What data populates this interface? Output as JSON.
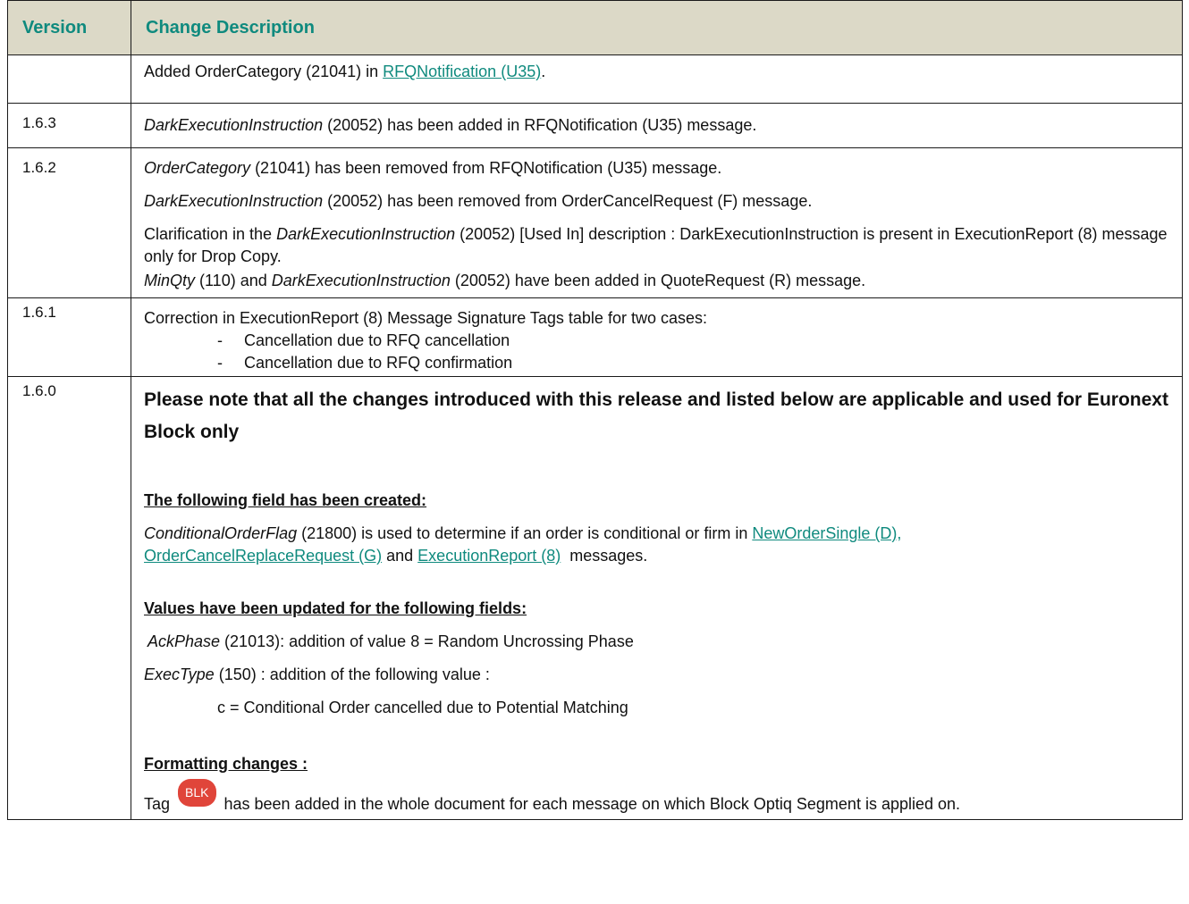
{
  "header": {
    "version": "Version",
    "change_description": "Change Description"
  },
  "row0": {
    "pre": "Added OrderCategory (21041) in ",
    "link": "RFQNotification (U35)",
    "post": "."
  },
  "row1": {
    "version": "1.6.3",
    "em": "DarkExecutionInstruction",
    "rest": " (20052) has been added in RFQNotification (U35) message."
  },
  "row2": {
    "version": "1.6.2",
    "l1_em": "OrderCategory",
    "l1_rest": " (21041) has been removed from RFQNotification (U35) message.",
    "l2_em": "DarkExecutionInstruction",
    "l2_rest": " (20052) has been removed from OrderCancelRequest (F) message.",
    "l3_pre": "Clarification in the ",
    "l3_em": "DarkExecutionInstruction",
    "l3_rest": " (20052) [Used In] description :  DarkExecutionInstruction is present in ExecutionReport (8) message only for Drop Copy.",
    "l4_em1": "MinQty",
    "l4_mid": " (110) and ",
    "l4_em2": "DarkExecutionInstruction",
    "l4_rest": " (20052) have been added in QuoteRequest (R) message."
  },
  "row3": {
    "version": "1.6.1",
    "intro": "Correction in ExecutionReport (8) Message Signature Tags table for two cases:",
    "items": [
      "Cancellation due to RFQ cancellation",
      "Cancellation due to RFQ confirmation"
    ],
    "dash": "-"
  },
  "row4": {
    "version": "1.6.0",
    "note": "Please note that all the changes introduced with this release and listed below are applicable and used for Euronext Block only",
    "h_created": "The following field has been created:",
    "created_em": "ConditionalOrderFlag",
    "created_rest": " (21800) is used to determine if an order is conditional or firm in ",
    "link1": "NewOrderSingle (D),",
    "link2": "OrderCancelReplaceRequest (G)",
    "and": " and ",
    "link3": " ExecutionReport (8)",
    "messages": "  messages.",
    "h_values": "Values have been updated for the following fields:",
    "ack_em": "AckPhase",
    "ack_rest": " (21013): addition of value 8 = Random Uncrossing Phase",
    "exec_em": "ExecType",
    "exec_rest": " (150) : addition of the following value :",
    "exec_value": "c = Conditional Order cancelled due to Potential Matching",
    "h_format": "Formatting changes :",
    "tag_pre": "Tag ",
    "badge": "BLK",
    "tag_rest": " has been added in the whole document for each message on which Block Optiq Segment is applied on."
  },
  "colors": {
    "header_bg": "#dcd9c7",
    "accent": "#0f8a7e",
    "badge": "#e0453a"
  }
}
